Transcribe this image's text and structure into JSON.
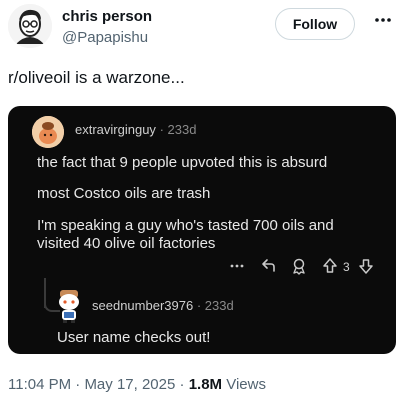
{
  "author": {
    "name": "chris person",
    "handle": "@Papapishu",
    "follow_label": "Follow"
  },
  "tweet": {
    "text": "r/oliveoil is a warzone..."
  },
  "embed": {
    "comment": {
      "username": "extravirginguy",
      "separator": "·",
      "age": "233d",
      "lines": [
        "the fact that 9 people upvoted this is absurd",
        "most Costco oils are trash",
        "I'm speaking a guy who's tasted 700 oils and",
        "visited 40 olive oil factories"
      ],
      "vote_count": "3"
    },
    "reply": {
      "username": "seednumber3976",
      "separator": "·",
      "age": "233d",
      "text": "User name checks out!"
    }
  },
  "footer": {
    "time": "11:04 PM",
    "sep1": "·",
    "date": "May 17, 2025",
    "sep2": "·",
    "views_count": "1.8M",
    "views_label": "Views"
  },
  "icons": {
    "more": "more-horizontal-icon",
    "reply": "reply-arrow-icon",
    "award": "award-icon",
    "upvote": "upvote-arrow-icon",
    "downvote": "downvote-arrow-icon",
    "comment_more": "ellipsis-icon"
  }
}
